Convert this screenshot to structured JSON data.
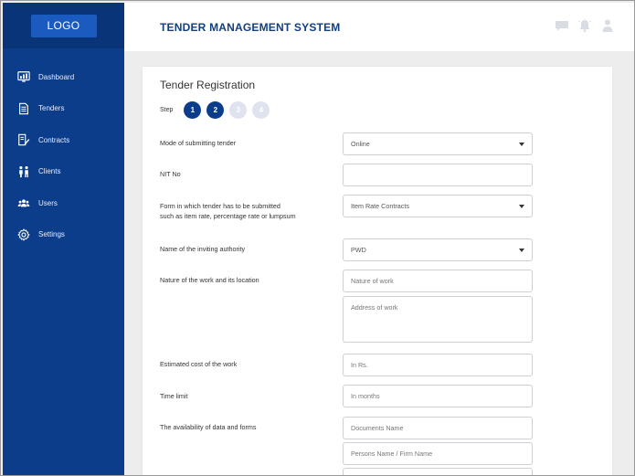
{
  "sidebar": {
    "logo": "LOGO",
    "items": [
      {
        "label": "Dashboard",
        "icon": "dashboard-icon"
      },
      {
        "label": "Tenders",
        "icon": "document-icon"
      },
      {
        "label": "Contracts",
        "icon": "contract-icon"
      },
      {
        "label": "Clients",
        "icon": "clients-icon"
      },
      {
        "label": "Users",
        "icon": "users-icon"
      },
      {
        "label": "Settings",
        "icon": "gear-icon"
      }
    ]
  },
  "header": {
    "title": "TENDER MANAGEMENT SYSTEM",
    "icons": [
      "chat-icon",
      "notification-bell-icon",
      "user-profile-icon"
    ]
  },
  "form": {
    "title": "Tender Registration",
    "step_label": "Step",
    "steps": [
      {
        "label": "1",
        "state": "completed"
      },
      {
        "label": "2",
        "state": "completed"
      },
      {
        "label": "3",
        "state": "pending"
      },
      {
        "label": "4",
        "state": "pending"
      }
    ],
    "fields": {
      "mode": {
        "label": "Mode of submitting tender",
        "value": "Online"
      },
      "nit": {
        "label": "NIT No",
        "value": ""
      },
      "form_type": {
        "label_line1": "Form in which tender has to be submitted",
        "label_line2": "such as item rate, percentage rate or lumpsum",
        "value": "Item Rate Contracts"
      },
      "authority": {
        "label": "Name of the inviting authority",
        "value": "PWD"
      },
      "nature": {
        "label": "Nature of the work and its location",
        "placeholder": "Nature of work",
        "address_placeholder": "Address of work"
      },
      "cost": {
        "label": "Estimated cost of the work",
        "placeholder": "In Rs."
      },
      "time": {
        "label": "Time limit",
        "placeholder": "In months"
      },
      "availability": {
        "label": "The availability of data and forms",
        "placeholder_docs": "Documents Name",
        "placeholder_persons": "Persons Name / Firm Name"
      }
    }
  },
  "colors": {
    "sidebar": "#0b3d8a",
    "logo_bg": "#0a3478",
    "logo_button": "#1b5bc0",
    "title": "#123f80",
    "step_active": "#0b3d8a",
    "step_inactive": "#dfe3ee"
  }
}
